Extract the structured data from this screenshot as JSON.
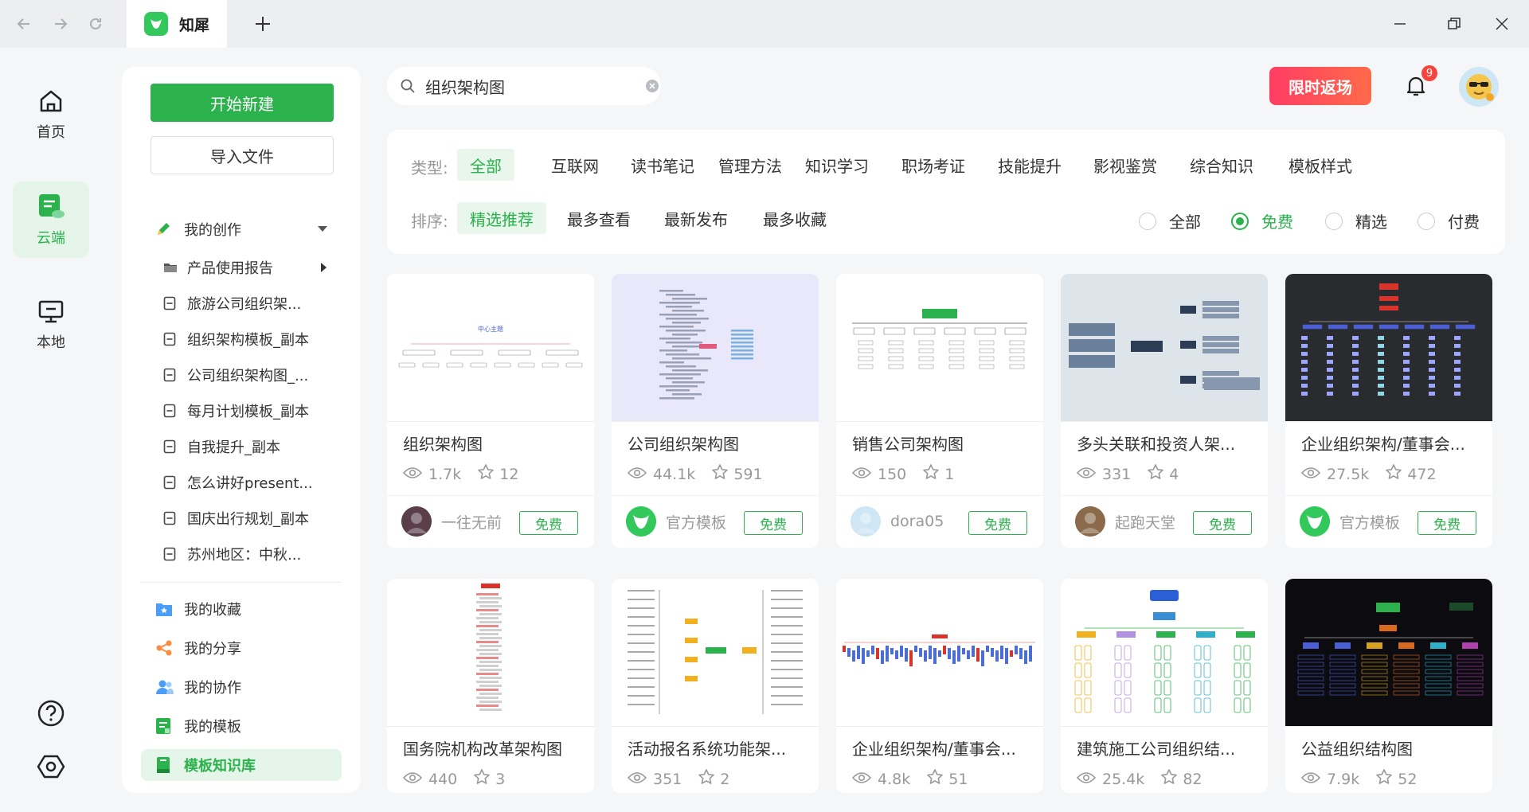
{
  "app": {
    "tab_title": "知犀",
    "accent": "#2bb24c"
  },
  "left_nav": [
    {
      "label": "首页",
      "icon": "home-icon"
    },
    {
      "label": "云端",
      "icon": "cloud-doc-icon",
      "active": true
    },
    {
      "label": "本地",
      "icon": "monitor-icon"
    }
  ],
  "bottom_icons": [
    "help-icon",
    "settings-icon"
  ],
  "side": {
    "new_btn": "开始新建",
    "import_btn": "导入文件",
    "my_creation": "我的创作",
    "folders": [
      {
        "label": "产品使用报告",
        "type": "folder"
      },
      {
        "label": "旅游公司组织架...",
        "type": "doc"
      },
      {
        "label": "组织架构模板_副本",
        "type": "doc"
      },
      {
        "label": "公司组织架构图_...",
        "type": "doc"
      },
      {
        "label": "每月计划模板_副本",
        "type": "doc"
      },
      {
        "label": "自我提升_副本",
        "type": "doc"
      },
      {
        "label": "怎么讲好present...",
        "type": "doc"
      },
      {
        "label": "国庆出行规划_副本",
        "type": "doc"
      },
      {
        "label": "苏州地区：中秋...",
        "type": "doc"
      }
    ],
    "menu": [
      {
        "label": "我的收藏",
        "icon": "star-folder-icon",
        "color": "#4a9ef7"
      },
      {
        "label": "我的分享",
        "icon": "share-icon",
        "color": "#ff8a3d"
      },
      {
        "label": "我的协作",
        "icon": "collab-icon",
        "color": "#4a9ef7"
      },
      {
        "label": "我的模板",
        "icon": "template-icon",
        "color": "#2bb24c"
      },
      {
        "label": "模板知识库",
        "icon": "library-icon",
        "color": "#2bb24c",
        "active": true
      }
    ]
  },
  "search": {
    "value": "组织架构图"
  },
  "header": {
    "promo": "限时返场",
    "notif_count": "9"
  },
  "filters": {
    "type_label": "类型:",
    "types": [
      "全部",
      "互联网",
      "读书笔记",
      "管理方法",
      "知识学习",
      "职场考证",
      "技能提升",
      "影视鉴赏",
      "综合知识",
      "模板样式"
    ],
    "sort_label": "排序:",
    "sorts": [
      "精选推荐",
      "最多查看",
      "最新发布",
      "最多收藏"
    ],
    "price": [
      "全部",
      "免费",
      "精选",
      "付费"
    ],
    "price_selected": 1
  },
  "cards": [
    {
      "title": "组织架构图",
      "views": "1.7k",
      "stars": "12",
      "author": "一往无前",
      "tag": "免费",
      "bg": "#ffffff",
      "av": "#5a3e4a"
    },
    {
      "title": "公司组织架构图",
      "views": "44.1k",
      "stars": "591",
      "author": "官方模板",
      "tag": "免费",
      "bg": "#e8e8fa",
      "av": "#33c85c"
    },
    {
      "title": "销售公司架构图",
      "views": "150",
      "stars": "1",
      "author": "dora05",
      "tag": "免费",
      "bg": "#ffffff",
      "av": "#cfe6f5"
    },
    {
      "title": "多头关联和投资人架...",
      "views": "331",
      "stars": "4",
      "author": "起跑天堂",
      "tag": "免费",
      "bg": "#dde4ea",
      "av": "#8a6a4a"
    },
    {
      "title": "企业组织架构/董事会...",
      "views": "27.5k",
      "stars": "472",
      "author": "官方模板",
      "tag": "免费",
      "bg": "#2a2b2e",
      "av": "#33c85c"
    },
    {
      "title": "国务院机构改革架构图",
      "views": "440",
      "stars": "3",
      "bg": "#ffffff"
    },
    {
      "title": "活动报名系统功能架...",
      "views": "351",
      "stars": "2",
      "bg": "#ffffff"
    },
    {
      "title": "企业组织架构/董事会...",
      "views": "4.8k",
      "stars": "51",
      "bg": "#ffffff"
    },
    {
      "title": "建筑施工公司组织结...",
      "views": "25.4k",
      "stars": "82",
      "bg": "#ffffff"
    },
    {
      "title": "公益组织结构图",
      "views": "7.9k",
      "stars": "52",
      "bg": "#0c0c10"
    }
  ]
}
